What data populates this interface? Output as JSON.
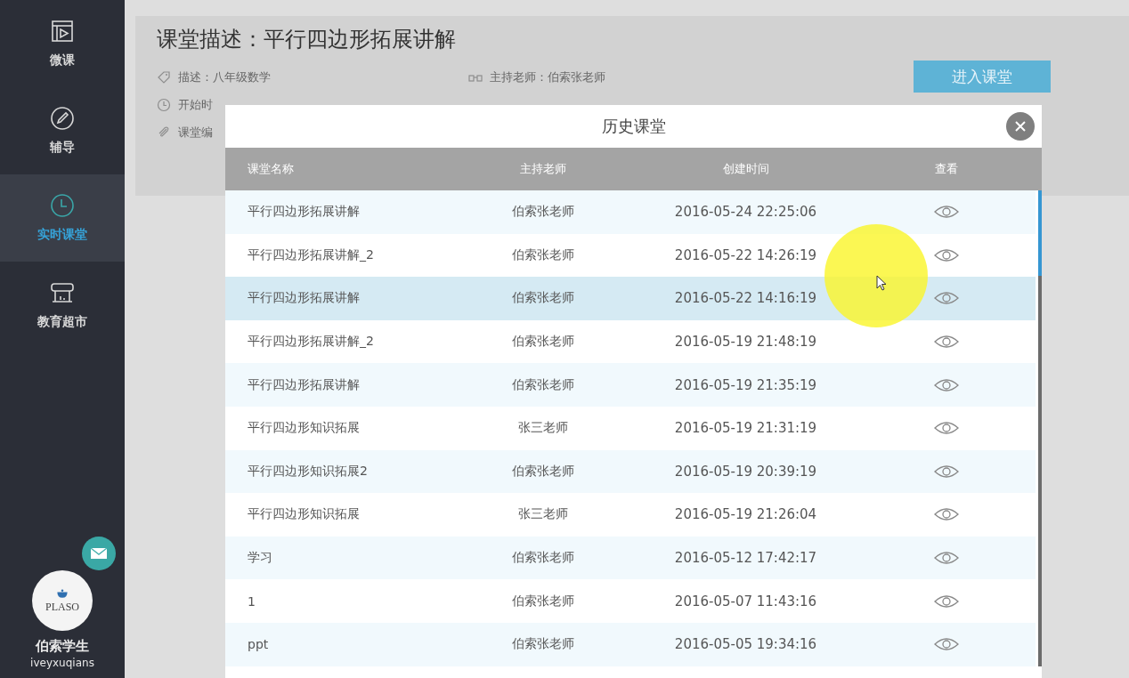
{
  "sidebar": {
    "items": [
      {
        "label": "微课",
        "kind": "video",
        "selected": false
      },
      {
        "label": "辅导",
        "kind": "pencil",
        "selected": false
      },
      {
        "label": "实时课堂",
        "kind": "clock",
        "selected": true
      },
      {
        "label": "教育超市",
        "kind": "store",
        "selected": false
      }
    ],
    "user": {
      "avatar_text": "PLASO",
      "name": "伯索学生",
      "username": "iveyxuqians"
    }
  },
  "lesson": {
    "title": "课堂描述：平行四边形拓展讲解",
    "fields_left": [
      {
        "kind": "tag",
        "text": "描述：八年级数学"
      },
      {
        "kind": "clock",
        "text": "开始时"
      },
      {
        "kind": "clip",
        "text": "课堂编"
      }
    ],
    "fields_right": [
      {
        "kind": "teacher",
        "text": "主持老师：伯索张老师"
      }
    ],
    "enter_button": "进入课堂"
  },
  "modal": {
    "title": "历史课堂",
    "columns": [
      "课堂名称",
      "主持老师",
      "创建时间",
      "查看"
    ],
    "rows": [
      {
        "name": "平行四边形拓展讲解",
        "teacher": "伯索张老师",
        "created": "2016-05-24 22:25:06",
        "selected": false
      },
      {
        "name": "平行四边形拓展讲解_2",
        "teacher": "伯索张老师",
        "created": "2016-05-22 14:26:19",
        "selected": false
      },
      {
        "name": "平行四边形拓展讲解",
        "teacher": "伯索张老师",
        "created": "2016-05-22 14:16:19",
        "selected": true
      },
      {
        "name": "平行四边形拓展讲解_2",
        "teacher": "伯索张老师",
        "created": "2016-05-19 21:48:19",
        "selected": false
      },
      {
        "name": "平行四边形拓展讲解",
        "teacher": "伯索张老师",
        "created": "2016-05-19 21:35:19",
        "selected": false
      },
      {
        "name": "平行四边形知识拓展",
        "teacher": "张三老师",
        "created": "2016-05-19 21:31:19",
        "selected": false
      },
      {
        "name": "平行四边形知识拓展2",
        "teacher": "伯索张老师",
        "created": "2016-05-19 20:39:19",
        "selected": false
      },
      {
        "name": "平行四边形知识拓展",
        "teacher": "张三老师",
        "created": "2016-05-19 21:26:04",
        "selected": false
      },
      {
        "name": "学习",
        "teacher": "伯索张老师",
        "created": "2016-05-12 17:42:17",
        "selected": false
      },
      {
        "name": "1",
        "teacher": "伯索张老师",
        "created": "2016-05-07 11:43:16",
        "selected": false
      },
      {
        "name": "ppt",
        "teacher": "伯索张老师",
        "created": "2016-05-05 19:34:16",
        "selected": false
      }
    ]
  }
}
